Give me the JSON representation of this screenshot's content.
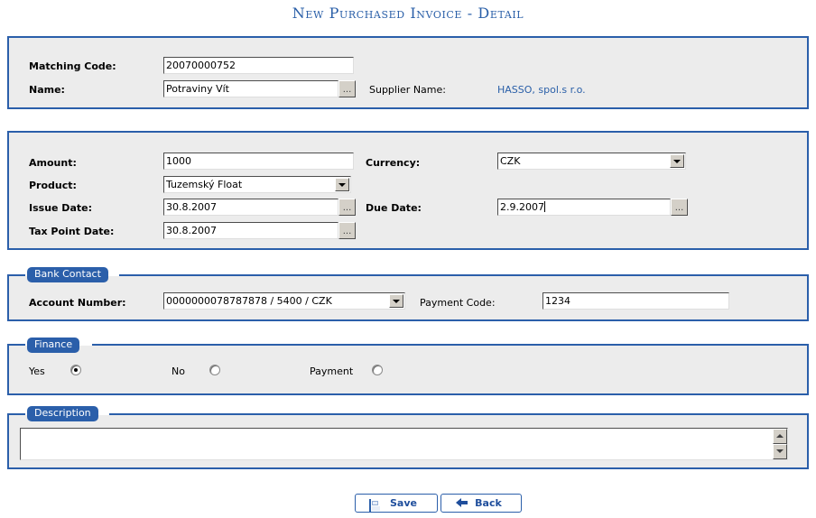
{
  "page": {
    "title": "New Purchased Invoice - Detail"
  },
  "identification": {
    "matching_code_label": "Matching Code:",
    "matching_code_value": "20070000752",
    "name_label": "Name:",
    "name_value": "Potraviny Vít",
    "name_browse_button": "...",
    "supplier_name_label": "Supplier Name:",
    "supplier_name_value": "HASSO, spol.s r.o."
  },
  "invoice": {
    "amount_label": "Amount:",
    "amount_value": "1000",
    "currency_label": "Currency:",
    "currency_value": "CZK",
    "product_label": "Product:",
    "product_value": "Tuzemský Float",
    "issue_date_label": "Issue Date:",
    "issue_date_value": "30.8.2007",
    "issue_date_browse_button": "...",
    "due_date_label": "Due Date:",
    "due_date_value": "2.9.2007",
    "due_date_browse_button": "...",
    "tax_point_date_label": "Tax Point Date:",
    "tax_point_date_value": "30.8.2007",
    "tax_point_date_browse_button": "..."
  },
  "bank_contact": {
    "legend": "Bank Contact",
    "account_number_label": "Account Number:",
    "account_number_value": "0000000078787878 / 5400 / CZK",
    "payment_code_label": "Payment Code:",
    "payment_code_value": "1234"
  },
  "finance": {
    "legend": "Finance",
    "options": [
      {
        "label": "Yes",
        "selected": true
      },
      {
        "label": "No",
        "selected": false
      },
      {
        "label": "Payment",
        "selected": false
      }
    ]
  },
  "description": {
    "legend": "Description",
    "value": ""
  },
  "footer": {
    "save_label": "Save",
    "back_label": "Back"
  },
  "colors": {
    "accent_blue": "#2b5faa",
    "title_blue": "#2a5fa8",
    "panel_bg": "#ececec",
    "page_bg": "#ffffff"
  }
}
